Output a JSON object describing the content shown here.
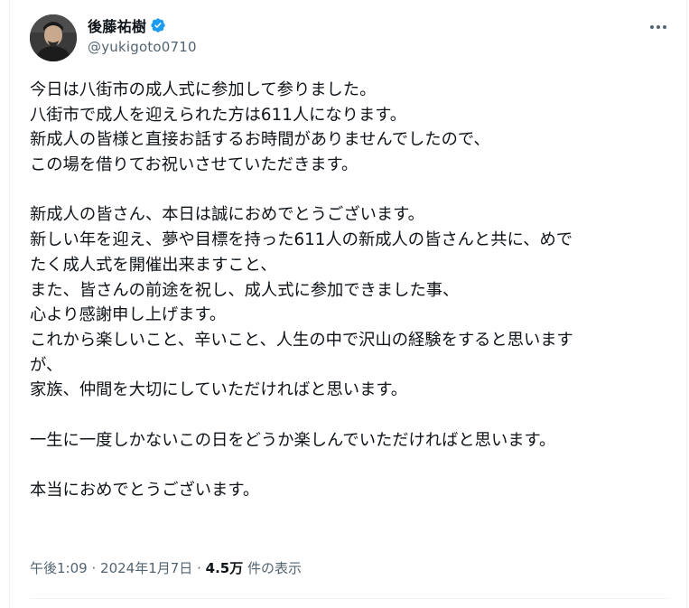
{
  "author": {
    "display_name": "後藤祐樹",
    "handle": "@yukigoto0710",
    "verified": true,
    "verified_color": "#1d9bf0"
  },
  "more_icon": "more-options-icon",
  "tweet": {
    "lines": [
      "今日は八街市の成人式に参加して参りました。",
      "八街市で成人を迎えられた方は611人になります。",
      "新成人の皆様と直接お話するお時間がありませんでしたので、",
      "この場を借りてお祝いさせていただきます。",
      "",
      "新成人の皆さん、本日は誠におめでとうございます。",
      "新しい年を迎え、夢や目標を持った611人の新成人の皆さんと共に、めで",
      "たく成人式を開催出来ますこと、",
      "また、皆さんの前途を祝し、成人式に参加できました事、",
      "心より感謝申し上げます。",
      "これから楽しいこと、辛いこと、人生の中で沢山の経験をすると思います",
      "が、",
      "家族、仲間を大切にしていただければと思います。",
      "",
      "一生に一度しかないこの日をどうか楽しんでいただければと思います。",
      "",
      "本当におめでとうございます。"
    ]
  },
  "meta": {
    "time": "午後1:09",
    "separator": "·",
    "date": "2024年1月7日",
    "views_count": "4.5万",
    "views_label": "件の表示"
  }
}
